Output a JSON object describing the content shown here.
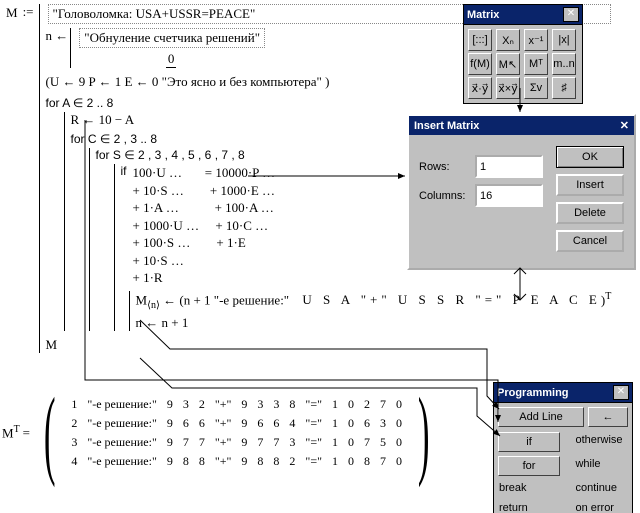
{
  "doc": {
    "title_comment": "\"Головоломка: USA+USSR=PEACE\"",
    "n_comment": "\"Обнуление счетчика решений\"",
    "n_init": "0",
    "uple_line": "(U ← 9   P ← 1   E ← 0   \"Это ясно и без компьютера\" )",
    "for1": "for   A ∈ 2 .. 8",
    "r_line": "R ← 10 − A",
    "for2": "for   C ∈ 2 , 3 .. 8",
    "for3": "for   S ∈ 2 , 3 , 4 , 5 , 6 , 7 , 8",
    "if_kw": "if",
    "eq": [
      "100·U …       = 10000·P …",
      "+ 10·S …        + 1000·E …",
      "+ 1·A …           + 100·A …",
      "+ 1000·U …     + 10·C …",
      "+ 100·S …        + 1·E",
      "+ 10·S …",
      "+ 1·R"
    ],
    "row_assign_left": "M",
    "row_assign_sup": "⟨n⟩",
    "row_assign_arrow": " ← (n + 1   \"-е решение:\"",
    "row_letters": "U S A \"+\" U S S R \"=\" P E A C E",
    "row_assign_sufT": "T",
    "n_incr": "n ← n + 1",
    "return_M": "M"
  },
  "result": {
    "label": "M",
    "sup": "T",
    "eq": "=",
    "rows": [
      [
        "1",
        "\"-е решение:\"",
        "9",
        "3",
        "2",
        "\"+\"",
        "9",
        "3",
        "3",
        "8",
        "\"=\"",
        "1",
        "0",
        "2",
        "7",
        "0"
      ],
      [
        "2",
        "\"-е решение:\"",
        "9",
        "6",
        "6",
        "\"+\"",
        "9",
        "6",
        "6",
        "4",
        "\"=\"",
        "1",
        "0",
        "6",
        "3",
        "0"
      ],
      [
        "3",
        "\"-е решение:\"",
        "9",
        "7",
        "7",
        "\"+\"",
        "9",
        "7",
        "7",
        "3",
        "\"=\"",
        "1",
        "0",
        "7",
        "5",
        "0"
      ],
      [
        "4",
        "\"-е решение:\"",
        "9",
        "8",
        "8",
        "\"+\"",
        "9",
        "8",
        "8",
        "2",
        "\"=\"",
        "1",
        "0",
        "8",
        "7",
        "0"
      ]
    ]
  },
  "matrix_pal": {
    "title": "Matrix",
    "btns": [
      "[:::]",
      "Xₙ",
      "x⁻¹",
      "|x|",
      "f(M)",
      "M↖",
      "Mᵀ",
      "m..n",
      "x⃗·y⃗",
      "x⃗×y⃗",
      "Σv",
      "♯"
    ]
  },
  "insert_dlg": {
    "title": "Insert Matrix",
    "rows_label": "Rows:",
    "cols_label": "Columns:",
    "rows_val": "1",
    "cols_val": "16",
    "ok": "OK",
    "insert": "Insert",
    "delete": "Delete",
    "cancel": "Cancel"
  },
  "prog_pal": {
    "title": "Programming",
    "add_line": "Add Line",
    "back": "←",
    "items": [
      "if",
      "otherwise",
      "for",
      "while",
      "break",
      "continue",
      "return",
      "on error"
    ]
  }
}
